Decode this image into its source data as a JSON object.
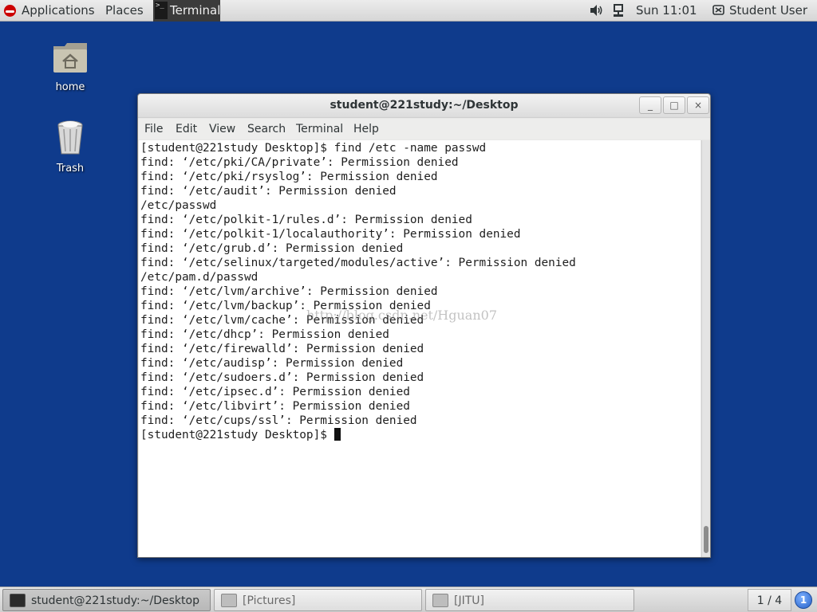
{
  "top_panel": {
    "applications": "Applications",
    "places": "Places",
    "active_app": "Terminal",
    "clock": "Sun 11:01",
    "user": "Student User"
  },
  "desktop": {
    "icons": [
      {
        "label": "home",
        "icon": "home-folder-icon"
      },
      {
        "label": "Trash",
        "icon": "trash-icon"
      }
    ]
  },
  "window": {
    "title": "student@221study:~/Desktop",
    "buttons": {
      "minimize": "_",
      "maximize": "□",
      "close": "×"
    },
    "menu": [
      "File",
      "Edit",
      "View",
      "Search",
      "Terminal",
      "Help"
    ],
    "terminal_lines": [
      "[student@221study Desktop]$ find /etc -name passwd",
      "find: ‘/etc/pki/CA/private’: Permission denied",
      "find: ‘/etc/pki/rsyslog’: Permission denied",
      "find: ‘/etc/audit’: Permission denied",
      "/etc/passwd",
      "find: ‘/etc/polkit-1/rules.d’: Permission denied",
      "find: ‘/etc/polkit-1/localauthority’: Permission denied",
      "find: ‘/etc/grub.d’: Permission denied",
      "find: ‘/etc/selinux/targeted/modules/active’: Permission denied",
      "/etc/pam.d/passwd",
      "find: ‘/etc/lvm/archive’: Permission denied",
      "find: ‘/etc/lvm/backup’: Permission denied",
      "find: ‘/etc/lvm/cache’: Permission denied",
      "find: ‘/etc/dhcp’: Permission denied",
      "find: ‘/etc/firewalld’: Permission denied",
      "find: ‘/etc/audisp’: Permission denied",
      "find: ‘/etc/sudoers.d’: Permission denied",
      "find: ‘/etc/ipsec.d’: Permission denied",
      "find: ‘/etc/libvirt’: Permission denied",
      "find: ‘/etc/cups/ssl’: Permission denied"
    ],
    "prompt": "[student@221study Desktop]$ ",
    "watermark": "http://blog.csdn.net/Hguan07"
  },
  "taskbar": {
    "tasks": [
      {
        "label": "student@221study:~/Desktop",
        "active": true
      },
      {
        "label": "[Pictures]",
        "active": false
      },
      {
        "label": "[JITU]",
        "active": false
      }
    ],
    "workspace": "1 / 4",
    "notifications": "1"
  }
}
